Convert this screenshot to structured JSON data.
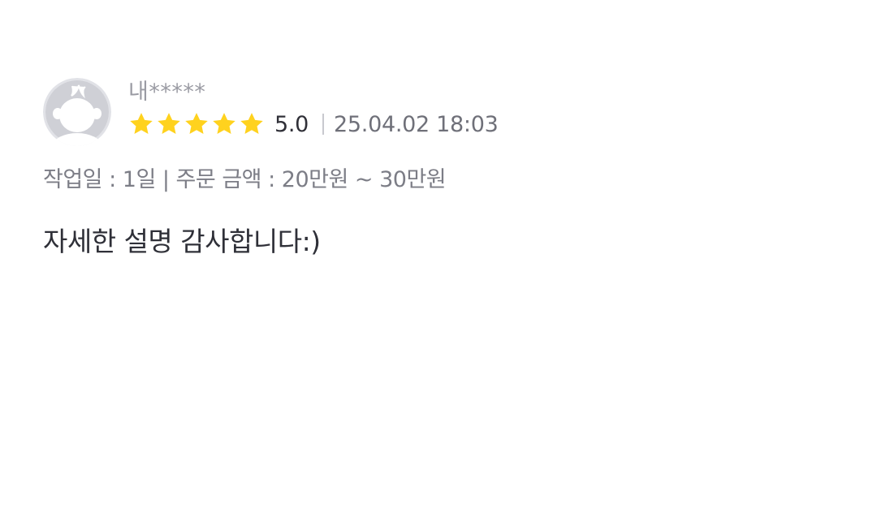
{
  "review": {
    "username": "내*****",
    "rating": {
      "stars_filled": 5,
      "stars_total": 5,
      "score_text": "5.0",
      "star_color": "#FFD21E"
    },
    "date": "25.04.02 18:03",
    "work_info": "작업일 : 1일 | 주문 금액 : 20만원 ~ 30만원",
    "comment": "자세한 설명 감사합니다:)",
    "avatar_icon": "default-profile-avatar-icon"
  }
}
